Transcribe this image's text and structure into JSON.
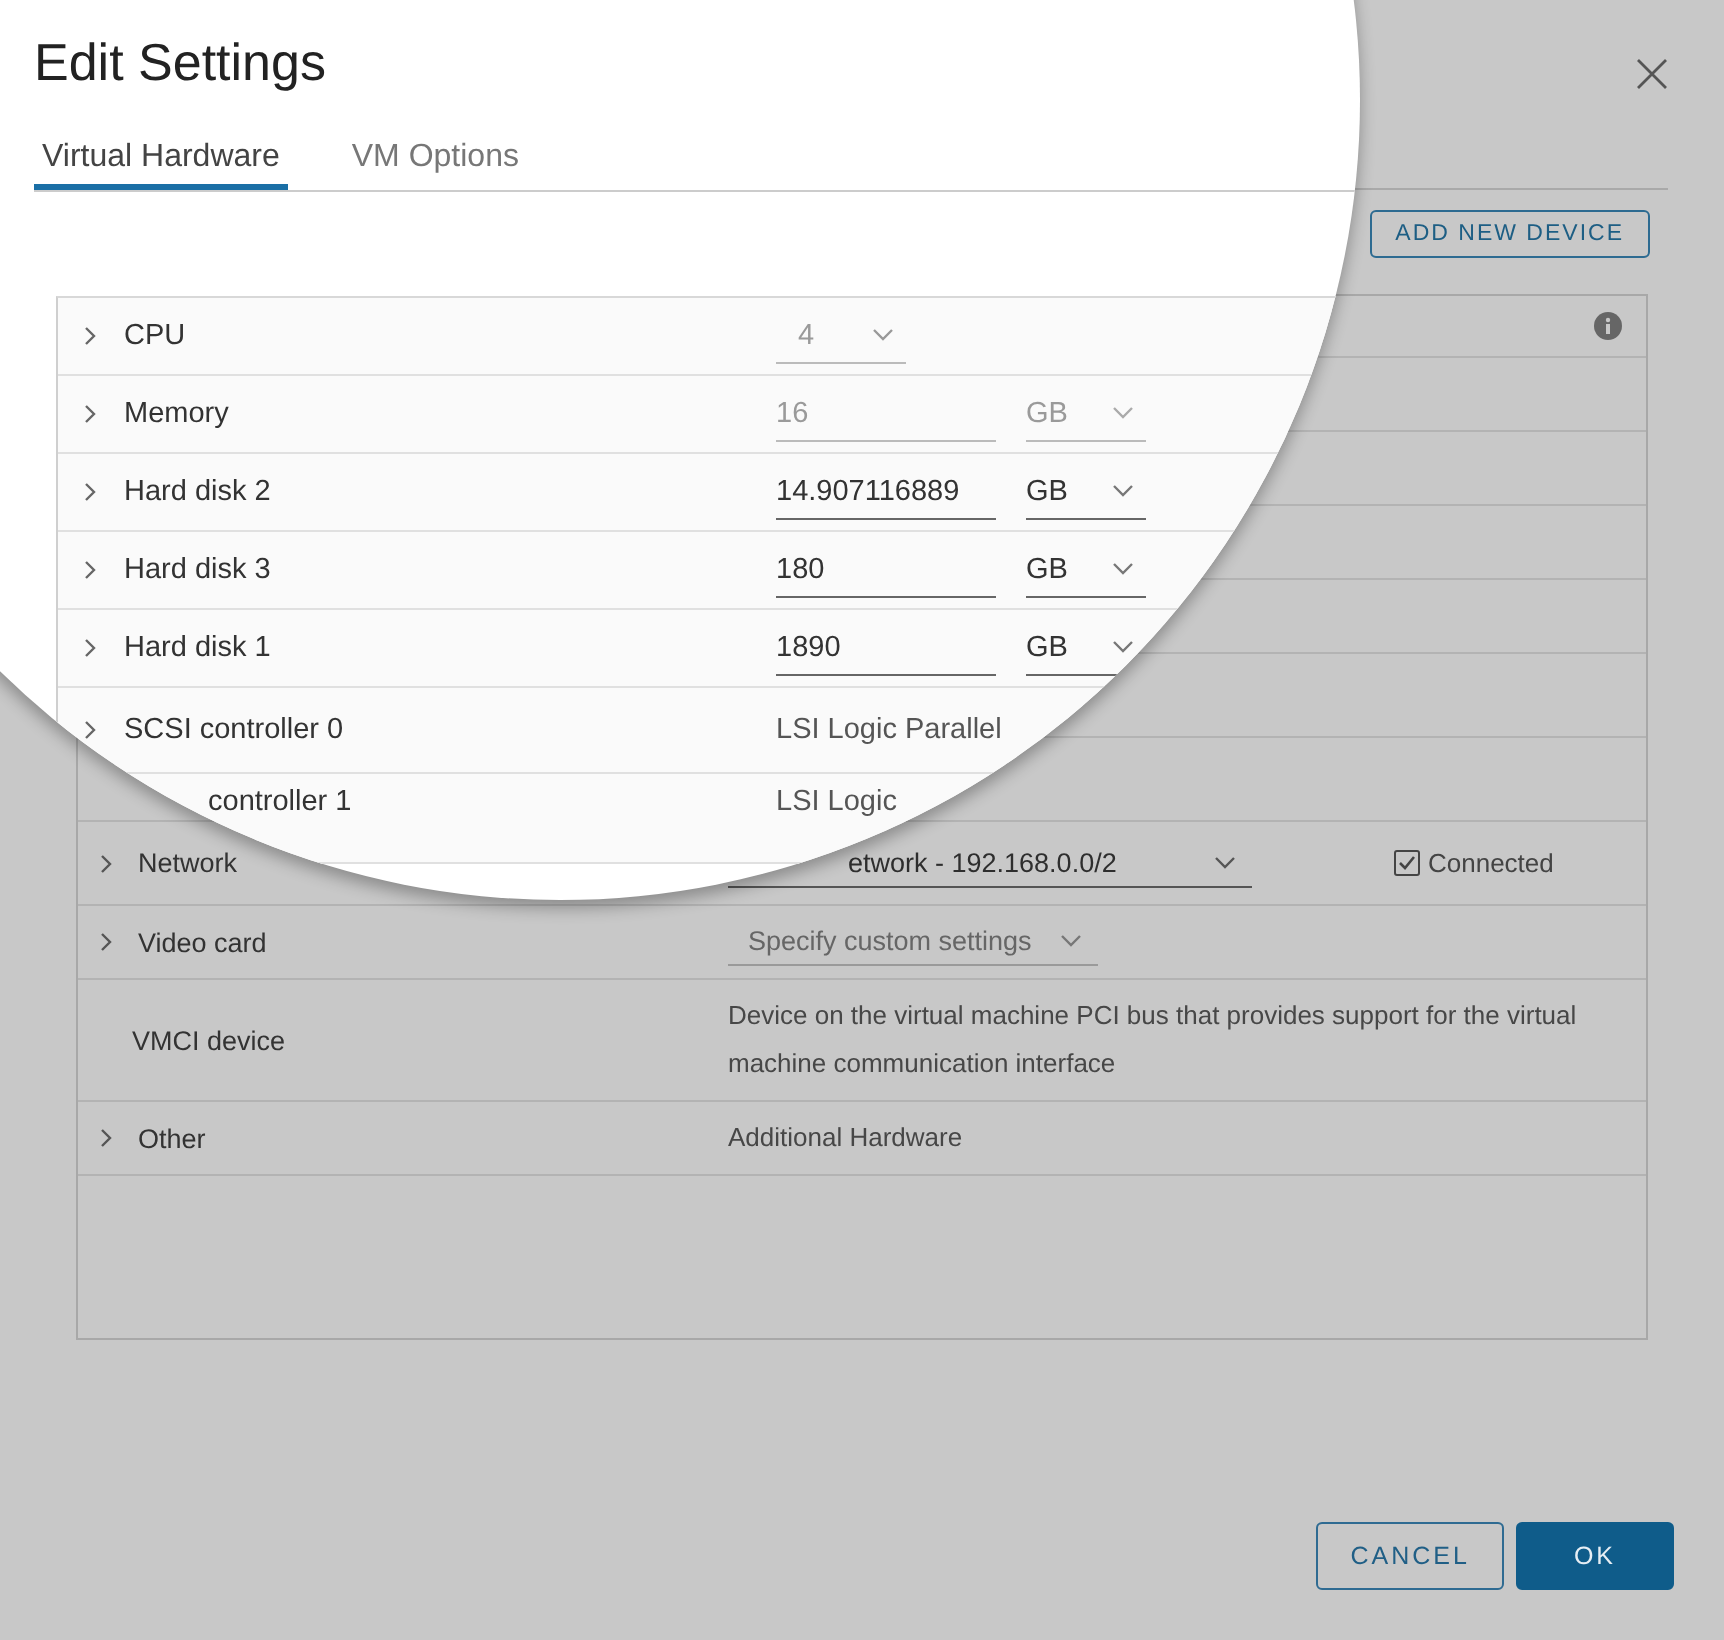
{
  "dialog": {
    "title": "Edit Settings"
  },
  "tabs": [
    {
      "label": "Virtual Hardware",
      "selected": true
    },
    {
      "label": "VM Options",
      "selected": false
    }
  ],
  "add_button": "ADD NEW DEVICE",
  "magnified_rows": [
    {
      "kind": "select",
      "label": "CPU",
      "value": "4",
      "disabled": true,
      "expandable": true
    },
    {
      "kind": "size",
      "label": "Memory",
      "value": "16",
      "unit": "GB",
      "disabled": true,
      "expandable": true
    },
    {
      "kind": "size",
      "label": "Hard disk 2",
      "value": "14.907116889",
      "unit": "GB",
      "disabled": false,
      "expandable": true
    },
    {
      "kind": "size",
      "label": "Hard disk 3",
      "value": "180",
      "unit": "GB",
      "disabled": false,
      "expandable": true
    },
    {
      "kind": "size",
      "label": "Hard disk 1",
      "value": "1890",
      "unit": "GB",
      "disabled": false,
      "expandable": true
    },
    {
      "kind": "text",
      "label": "SCSI controller 0",
      "value": "LSI Logic Parallel",
      "expandable": true
    },
    {
      "kind": "text",
      "label": "controller 1",
      "value": "LSI Logic"
    }
  ],
  "rows": [
    {
      "kind": "select",
      "label": "Network",
      "value": "etwork - 192.168.0.0/2",
      "disabled": false,
      "expandable": true,
      "checkbox": {
        "label": "Connected",
        "checked": true
      }
    },
    {
      "kind": "select",
      "label": "Video card",
      "value": "Specify custom settings",
      "disabled": true,
      "expandable": true
    },
    {
      "kind": "text",
      "label": "VMCI device",
      "value": "Device on the virtual machine PCI bus that provides support for the virtual machine communication interface",
      "expandable": false
    },
    {
      "kind": "text",
      "label": "Other",
      "value": "Additional Hardware",
      "expandable": true
    }
  ],
  "footer_buttons": [
    {
      "label": "CANCEL",
      "kind": "outline"
    },
    {
      "label": "OK",
      "kind": "primary"
    }
  ]
}
